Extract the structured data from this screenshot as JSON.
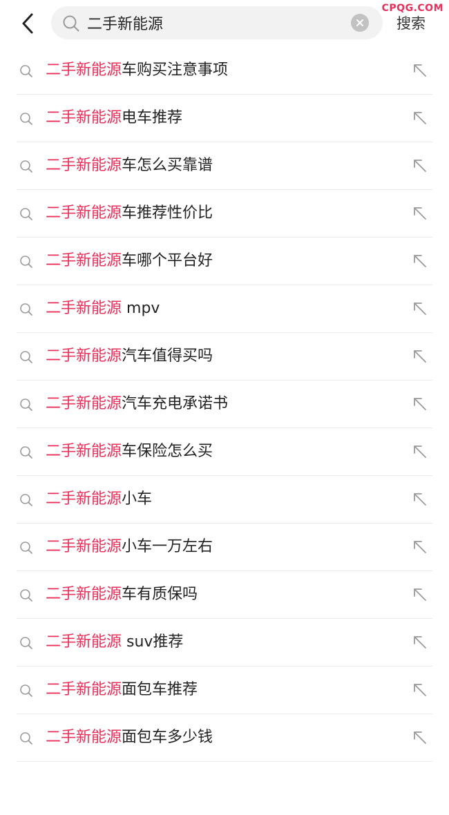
{
  "header": {
    "search_query": "二手新能源",
    "search_button_label": "搜索",
    "watermark_text": "CPQG.COM"
  },
  "suggestions": [
    {
      "highlight": "二手新能源",
      "rest": "车购买注意事项"
    },
    {
      "highlight": "二手新能源",
      "rest": "电车推荐"
    },
    {
      "highlight": "二手新能源",
      "rest": "车怎么买靠谱"
    },
    {
      "highlight": "二手新能源",
      "rest": "车推荐性价比"
    },
    {
      "highlight": "二手新能源",
      "rest": "车哪个平台好"
    },
    {
      "highlight": "二手新能源",
      "rest": " mpv"
    },
    {
      "highlight": "二手新能源",
      "rest": "汽车值得买吗"
    },
    {
      "highlight": "二手新能源",
      "rest": "汽车充电承诺书"
    },
    {
      "highlight": "二手新能源",
      "rest": "车保险怎么买"
    },
    {
      "highlight": "二手新能源",
      "rest": "小车"
    },
    {
      "highlight": "二手新能源",
      "rest": "小车一万左右"
    },
    {
      "highlight": "二手新能源",
      "rest": "车有质保吗"
    },
    {
      "highlight": "二手新能源",
      "rest": " suv推荐"
    },
    {
      "highlight": "二手新能源",
      "rest": "面包车推荐"
    },
    {
      "highlight": "二手新能源",
      "rest": "面包车多少钱"
    }
  ],
  "colors": {
    "highlight": "#e8305a",
    "text": "#222222",
    "divider": "#eaeaea",
    "search_bg": "#f2f2f2"
  },
  "icons": {
    "back": "chevron-left-icon",
    "search": "search-icon",
    "clear": "clear-icon",
    "fill": "arrow-up-left-icon"
  }
}
